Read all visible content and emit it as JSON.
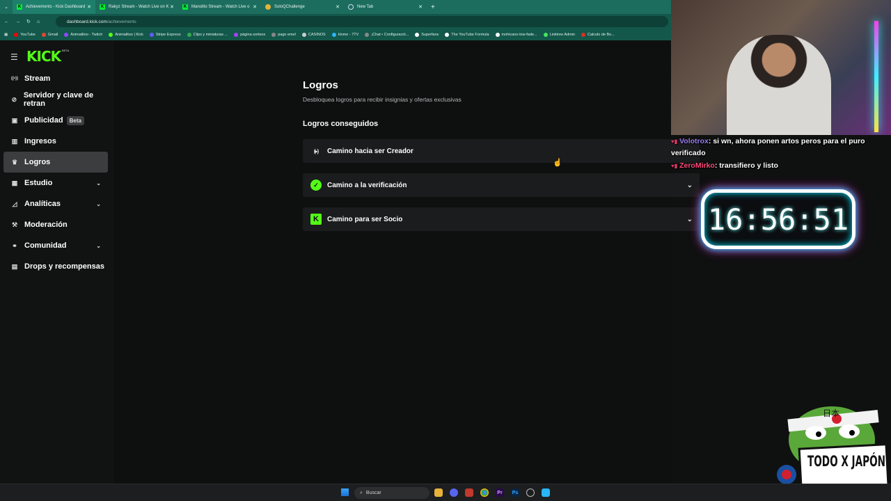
{
  "browser": {
    "tabs": [
      {
        "title": "Achievements - Kick Dashboard",
        "icon": "kick-icon",
        "active": true
      },
      {
        "title": "Rakyz Stream - Watch Live on K",
        "icon": "kick-icon",
        "active": false
      },
      {
        "title": "Manolito Stream - Watch Live o",
        "icon": "kick-icon",
        "active": false
      },
      {
        "title": "SoloQChallenge",
        "icon": "soloq-icon",
        "active": false
      },
      {
        "title": "New Tab",
        "icon": "globe-icon",
        "active": false
      }
    ],
    "url_host": "dashboard.kick.com",
    "url_path": "/achievements",
    "bookmarks": [
      {
        "label": "YouTube",
        "color": "#ff0000"
      },
      {
        "label": "Gmail",
        "color": "#ea4335"
      },
      {
        "label": "Animalitoo - Twitch",
        "color": "#9146ff"
      },
      {
        "label": "Animalitoo | Kick",
        "color": "#53fc18"
      },
      {
        "label": "Stripe Express",
        "color": "#635bff"
      },
      {
        "label": "Clips y miniaturas ...",
        "color": "#34a853"
      },
      {
        "label": "página sorteos",
        "color": "#a142f4"
      },
      {
        "label": "pago emel",
        "color": "#888888"
      },
      {
        "label": "CASINOS",
        "color": "#cccccc"
      },
      {
        "label": "Home - 7TV",
        "color": "#29b6f6"
      },
      {
        "label": "¡Chat • Configuració...",
        "color": "#888888"
      },
      {
        "label": "Superfans",
        "color": "#ffffff"
      },
      {
        "label": "The YouTube Formula",
        "color": "#ffffff"
      },
      {
        "label": "mohicano-low-fade...",
        "color": "#ffffff"
      },
      {
        "label": "Linktree Admin",
        "color": "#43e55e"
      },
      {
        "label": "Calculo de Bo...",
        "color": "#d93025"
      }
    ]
  },
  "sidebar": {
    "logo": "KICK",
    "logo_beta": "BETA",
    "items": [
      {
        "label": "Stream",
        "icon": "broadcast-icon",
        "name": "sidebar-item-stream"
      },
      {
        "label": "Servidor y clave de retran",
        "icon": "link-icon",
        "name": "sidebar-item-servidor"
      },
      {
        "label": "Publicidad",
        "icon": "ad-icon",
        "name": "sidebar-item-publicidad",
        "badge": "Beta"
      },
      {
        "label": "Ingresos",
        "icon": "chart-icon",
        "name": "sidebar-item-ingresos"
      },
      {
        "label": "Logros",
        "icon": "trophy-icon",
        "name": "sidebar-item-logros",
        "active": true
      },
      {
        "label": "Estudio",
        "icon": "layout-icon",
        "name": "sidebar-item-estudio",
        "expandable": true
      },
      {
        "label": "Analíticas",
        "icon": "analytics-icon",
        "name": "sidebar-item-analiticas",
        "expandable": true
      },
      {
        "label": "Moderación",
        "icon": "wrench-icon",
        "name": "sidebar-item-moderacion"
      },
      {
        "label": "Comunidad",
        "icon": "community-icon",
        "name": "sidebar-item-comunidad",
        "expandable": true
      },
      {
        "label": "Drops y recompensas",
        "icon": "gift-icon",
        "name": "sidebar-item-drops"
      }
    ]
  },
  "main": {
    "title": "Logros",
    "subtitle": "Desbloquea logros para recibir insignias y ofertas exclusivas",
    "section_title": "Logros conseguidos",
    "cards": [
      {
        "label": "Camino hacia ser Creador",
        "icon": "creator-icon"
      },
      {
        "label": "Camino a la verificación",
        "icon": "verified-icon"
      },
      {
        "label": "Camino para ser Socio",
        "icon": "kick-partner-icon"
      }
    ]
  },
  "overlay": {
    "chat": [
      {
        "user": "Volotrox",
        "message": "si wn, ahora ponen artos peros para el puro verificado"
      },
      {
        "user": "ZeroMirko",
        "message": "transifiero y listo"
      }
    ],
    "timer": "16:56:51",
    "sticker_text_top": "日本",
    "sticker_text": "TODO X JAPÓN"
  },
  "taskbar": {
    "search_placeholder": "Buscar"
  },
  "colors": {
    "kick_green": "#53fc18",
    "tab_bar": "#1c6d5e",
    "active_nav": "#3b3d3e"
  }
}
